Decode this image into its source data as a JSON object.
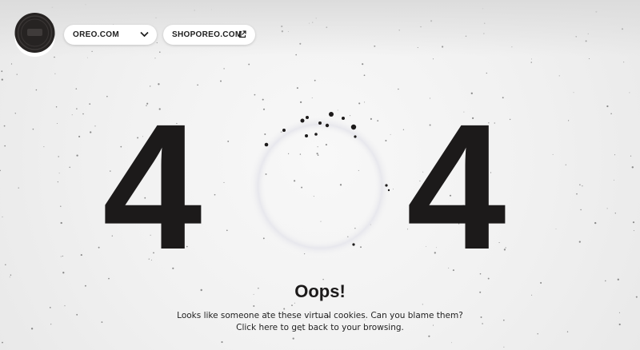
{
  "header": {
    "brand_logo": "oreo-cookie-logo",
    "site_menu": {
      "label": "OREO.COM",
      "icon": "chevron-down-icon"
    },
    "shop_link": {
      "label": "SHOPOREO.COM",
      "icon": "external-link-icon"
    }
  },
  "error": {
    "left_digit": "4",
    "right_digit": "4",
    "middle_glyph": "bitten-cookie-ring",
    "title": "Oops!",
    "message": "Looks like someone ate these virtual cookies. Can you blame them?",
    "link_text": "Click here to get back to your browsing."
  },
  "colors": {
    "background": "#f1f1f1",
    "digits": "#1c1a1a",
    "pill_bg": "#ffffff"
  }
}
